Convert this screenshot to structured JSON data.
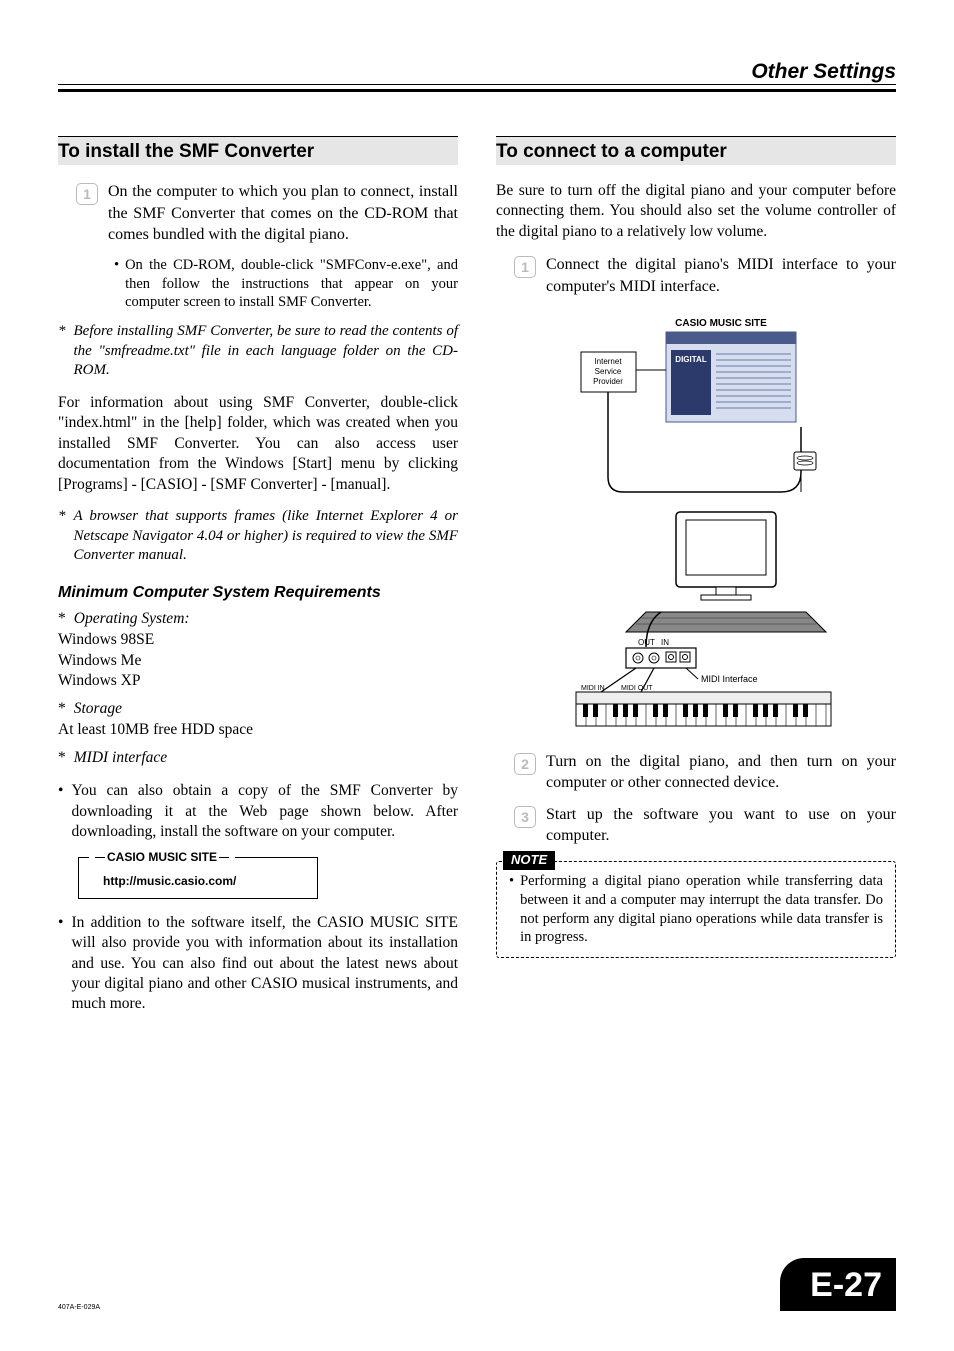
{
  "header": {
    "title": "Other Settings"
  },
  "left": {
    "section_title": "To install the SMF Converter",
    "step1": "On the computer to which you plan to connect, install the SMF Converter that comes on the CD-ROM that comes bundled with the digital piano.",
    "step1_sub": "On the CD-ROM, double-click \"SMFConv-e.exe\", and then follow the instructions that appear on your computer screen to install SMF Converter.",
    "star1": "Before installing SMF Converter, be sure to read the contents of the \"smfreadme.txt\" file in each language folder on the CD-ROM.",
    "body1": "For information about using SMF Converter, double-click \"index.html\" in the [help] folder, which was created when you installed SMF Converter. You can also access user documentation from the Windows [Start] menu by clicking [Programs] - [CASIO] - [SMF Converter] - [manual].",
    "star2": "A browser that supports frames (like Internet Explorer 4 or Netscape Navigator 4.04 or higher) is required to view the SMF Converter manual.",
    "subhead": "Minimum Computer System Requirements",
    "os_label": "Operating System:",
    "os1": "Windows 98SE",
    "os2": "Windows Me",
    "os3": "Windows XP",
    "storage_label": "Storage",
    "storage_req": "At least 10MB free HDD space",
    "midi_label": "MIDI interface",
    "bullet1": "You can also obtain a copy of the SMF Converter by downloading it at the Web page shown below. After downloading, install the software on your computer.",
    "casio_box_label": "CASIO MUSIC SITE",
    "casio_url": "http://music.casio.com/",
    "bullet2": "In addition to the software itself, the CASIO MUSIC SITE will also provide you with information about its installation and use. You can also find out about the latest news about your digital piano and other CASIO musical instruments, and much more."
  },
  "right": {
    "section_title": "To connect to a computer",
    "intro": "Be sure to turn off the digital piano and your computer before connecting them. You should also set the volume controller of the digital piano to a relatively low volume.",
    "step1": "Connect the digital piano's MIDI interface to your computer's MIDI interface.",
    "diagram": {
      "site_label": "CASIO MUSIC SITE",
      "isp": "Internet\nService\nProvider",
      "out": "OUT",
      "in": "IN",
      "midi_iface": "MIDI Interface",
      "midi_in": "MIDI IN",
      "midi_out": "MIDI OUT"
    },
    "step2": "Turn on the digital piano, and then turn on your computer or other connected device.",
    "step3": "Start up the software you want to use on your computer.",
    "note_label": "NOTE",
    "note_text": "Performing a digital piano operation while transferring data between it and a computer may interrupt the data transfer. Do not perform any digital piano operations while data transfer is in progress."
  },
  "footer": {
    "code": "407A-E-029A",
    "page": "E-27"
  }
}
